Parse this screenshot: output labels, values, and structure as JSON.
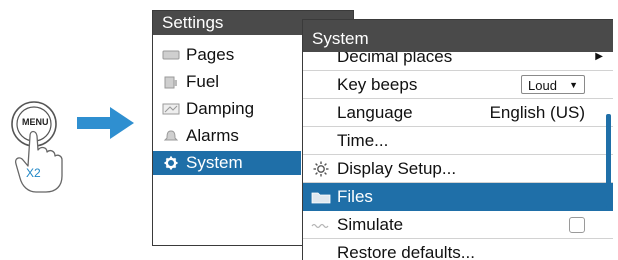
{
  "hint": {
    "button_label": "MENU",
    "press_count": "X2"
  },
  "settings": {
    "title": "Settings",
    "items": [
      {
        "label": "Pages",
        "icon": "pages-icon"
      },
      {
        "label": "Fuel",
        "icon": "fuel-icon"
      },
      {
        "label": "Damping",
        "icon": "damping-icon"
      },
      {
        "label": "Alarms",
        "icon": "alarms-icon"
      },
      {
        "label": "System",
        "icon": "system-gear-icon",
        "selected": true
      }
    ]
  },
  "system": {
    "title": "System",
    "rows": [
      {
        "label": "Decimal places",
        "has_submenu": true
      },
      {
        "label": "Key beeps",
        "dropdown": "Loud"
      },
      {
        "label": "Language",
        "value": "English (US)"
      },
      {
        "label": "Time..."
      },
      {
        "label": "Display Setup...",
        "icon": "display-setup-icon"
      },
      {
        "label": "Files",
        "icon": "folder-icon",
        "selected": true
      },
      {
        "label": "Simulate",
        "icon": "simulate-icon",
        "checkbox": false
      },
      {
        "label": "Restore defaults..."
      }
    ]
  },
  "colors": {
    "titlebar": "#4a4a4a",
    "selection": "#1f6fa8",
    "arrow": "#2f8fd0",
    "hint_text": "#1f86c6"
  }
}
